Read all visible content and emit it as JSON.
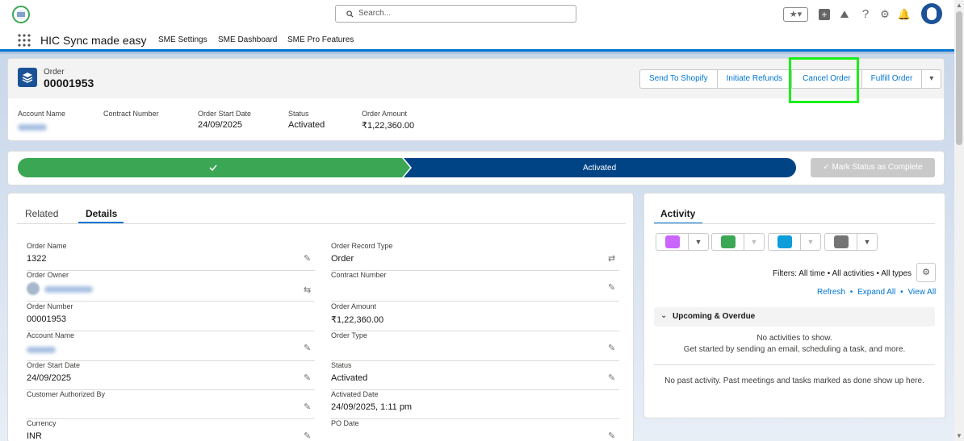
{
  "search": {
    "placeholder": "Search..."
  },
  "app": {
    "name": "HIC Sync made easy"
  },
  "nav": {
    "items": [
      "SME Settings",
      "SME Dashboard",
      "SME Pro Features"
    ]
  },
  "header": {
    "object_label": "Order",
    "record_name": "00001953",
    "actions": [
      "Send To Shopify",
      "Initiate Refunds",
      "Cancel Order",
      "Fulfill Order"
    ],
    "fields": [
      {
        "label": "Account Name",
        "value": "hic1333"
      },
      {
        "label": "Contract Number",
        "value": ""
      },
      {
        "label": "Order Start Date",
        "value": "24/09/2025"
      },
      {
        "label": "Status",
        "value": "Activated"
      },
      {
        "label": "Order Amount",
        "value": "₹1,22,360.00"
      }
    ]
  },
  "path": {
    "current": "Activated",
    "mark_button": "Mark Status as Complete"
  },
  "tabs": {
    "related": "Related",
    "details": "Details"
  },
  "details": {
    "left": [
      {
        "label": "Order Name",
        "value": "1322"
      },
      {
        "label": "Order Owner",
        "value": "Jaspal Mishra"
      },
      {
        "label": "Order Number",
        "value": "00001953"
      },
      {
        "label": "Account Name",
        "value": "hic1333"
      },
      {
        "label": "Order Start Date",
        "value": "24/09/2025"
      },
      {
        "label": "Customer Authorized By",
        "value": ""
      },
      {
        "label": "Currency",
        "value": "INR"
      }
    ],
    "right": [
      {
        "label": "Order Record Type",
        "value": "Order"
      },
      {
        "label": "Contract Number",
        "value": ""
      },
      {
        "label": "Order Amount",
        "value": "₹1,22,360.00"
      },
      {
        "label": "Order Type",
        "value": ""
      },
      {
        "label": "Status",
        "value": "Activated"
      },
      {
        "label": "Activated Date",
        "value": "24/09/2025, 1:11 pm"
      },
      {
        "label": "PO Date",
        "value": ""
      }
    ]
  },
  "activity": {
    "title": "Activity",
    "filters": "Filters: All time • All activities • All types",
    "refresh": "Refresh",
    "expand_all": "Expand All",
    "view_all": "View All",
    "upcoming": "Upcoming & Overdue",
    "no_activities": "No activities to show.",
    "get_started": "Get started by sending an email, scheduling a task, and more.",
    "no_past": "No past activity. Past meetings and tasks marked as done show up here."
  },
  "colors": {
    "brand": "#0176d3",
    "complete": "#3ba755",
    "current": "#014486",
    "highlight": "#1af01a"
  }
}
